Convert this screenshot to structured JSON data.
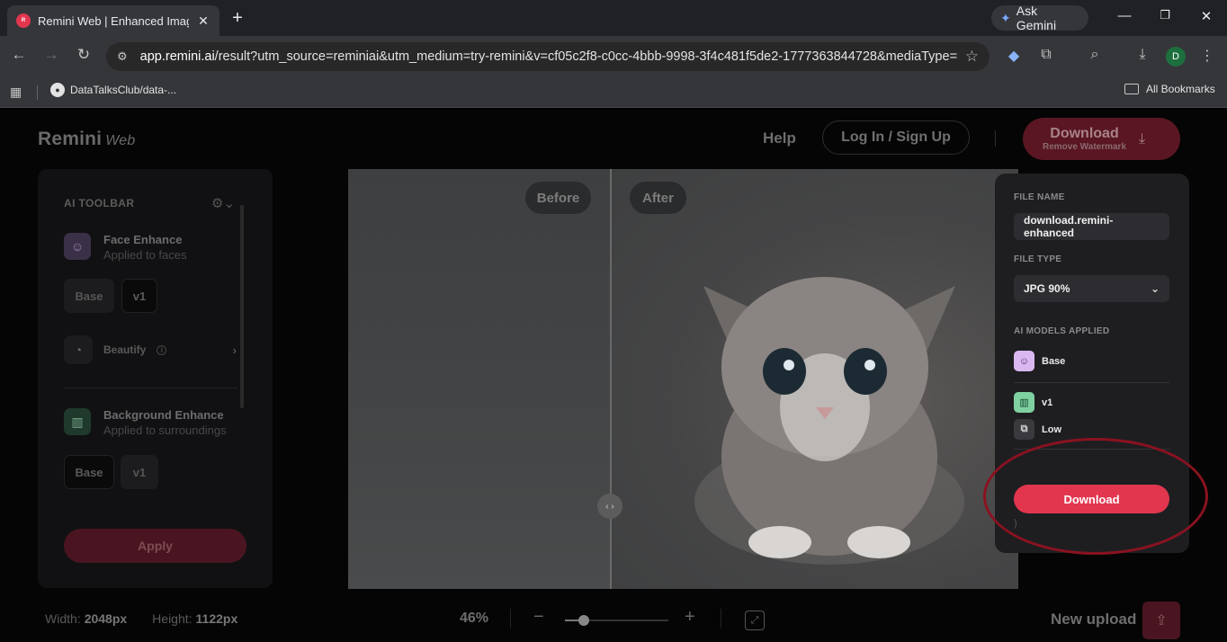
{
  "browser": {
    "tab_title": "Remini Web | Enhanced Image",
    "tab_close": "✕",
    "new_tab": "+",
    "ask_gemini": "Ask Gemini",
    "url_domain": "app.remini.ai",
    "url_rest": "/result?utm_source=reminiai&utm_medium=try-remini&v=cf05c2f8-c0cc-4bbb-9998-3f4c481f5de2-1777363844728&mediaType=i...",
    "profile_initial": "D",
    "bookmark_1": "DataTalksClub/data-...",
    "all_bookmarks": "All Bookmarks"
  },
  "header": {
    "logo": "Remini",
    "logo_sub": "Web",
    "help": "Help",
    "login": "Log In / Sign Up",
    "download_main": "Download",
    "download_sub": "Remove Watermark"
  },
  "toolbar": {
    "title": "AI TOOLBAR",
    "face": {
      "name": "Face Enhance",
      "sub": "Applied to faces",
      "chip_base": "Base",
      "chip_v1": "v1"
    },
    "beautify": "Beautify",
    "background": {
      "name": "Background Enhance",
      "sub": "Applied to surroundings",
      "chip_base": "Base",
      "chip_v1": "v1"
    },
    "apply": "Apply"
  },
  "viewer": {
    "before": "Before",
    "after": "After"
  },
  "download_panel": {
    "file_name_label": "FILE NAME",
    "file_name_value": "download.remini-enhanced",
    "file_type_label": "FILE TYPE",
    "file_type_value": "JPG 90%",
    "models_label": "AI MODELS APPLIED",
    "models": [
      "Base",
      "v1",
      "Low"
    ],
    "download_button": "Download",
    "ghost_text": ")"
  },
  "bottom": {
    "width_label": "Width:",
    "width_value": "2048px",
    "height_label": "Height:",
    "height_value": "1122px",
    "zoom": "46%",
    "new_upload": "New upload"
  },
  "colors": {
    "accent": "#e2364f",
    "annotation": "#8a1220"
  },
  "icons": [
    "gear-icon",
    "chevron-down-icon",
    "chevron-right-icon",
    "info-icon",
    "minus-icon",
    "plus-icon",
    "fit-screen-icon",
    "upload-icon",
    "download-icon"
  ]
}
